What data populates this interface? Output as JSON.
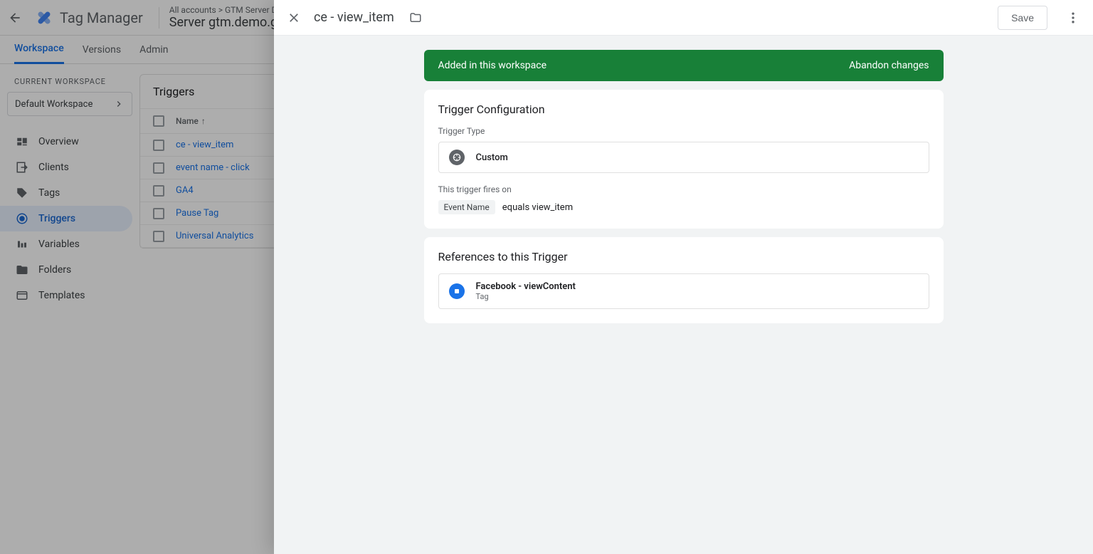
{
  "header": {
    "product": "Tag Manager",
    "breadcrumb": "All accounts > GTM Server Demo",
    "container": "Server gtm.demo.gtm-"
  },
  "tabs": {
    "workspace": "Workspace",
    "versions": "Versions",
    "admin": "Admin"
  },
  "sidebar": {
    "section_label": "CURRENT WORKSPACE",
    "workspace_name": "Default Workspace",
    "items": [
      {
        "label": "Overview"
      },
      {
        "label": "Clients"
      },
      {
        "label": "Tags"
      },
      {
        "label": "Triggers"
      },
      {
        "label": "Variables"
      },
      {
        "label": "Folders"
      },
      {
        "label": "Templates"
      }
    ]
  },
  "triggers_panel": {
    "title": "Triggers",
    "col_name": "Name",
    "rows": [
      {
        "name": "ce - view_item"
      },
      {
        "name": "event name - click"
      },
      {
        "name": "GA4"
      },
      {
        "name": "Pause Tag"
      },
      {
        "name": "Universal Analytics"
      }
    ]
  },
  "detail": {
    "title": "ce - view_item",
    "save": "Save",
    "banner_text": "Added in this workspace",
    "banner_action": "Abandon changes",
    "config_heading": "Trigger Configuration",
    "type_label": "Trigger Type",
    "type_value": "Custom",
    "fires_label": "This trigger fires on",
    "fires_variable": "Event Name",
    "fires_condition": "equals view_item",
    "refs_heading": "References to this Trigger",
    "ref_name": "Facebook - viewContent",
    "ref_kind": "Tag"
  }
}
